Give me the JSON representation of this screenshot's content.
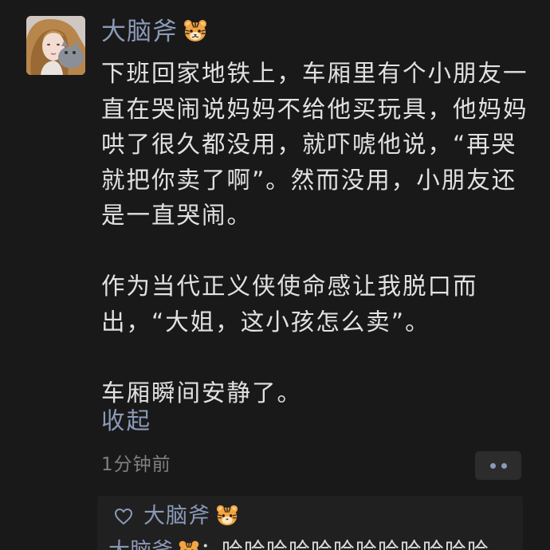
{
  "post": {
    "author": "大脑斧",
    "author_badge_icon": "tiger-face-icon",
    "paragraphs": [
      "下班回家地铁上，车厢里有个小朋友一直在哭闹说妈妈不给他买玩具，他妈妈哄了很久都没用，就吓唬他说，“再哭就把你卖了啊”。然而没用，小朋友还是一直哭闹。",
      "作为当代正义侠使命感让我脱口而出，“大姐，这小孩怎么卖”。",
      "车厢瞬间安静了。"
    ],
    "collapse_label": "收起",
    "timestamp": "1分钟前",
    "more_icon": "more-dots-icon"
  },
  "likes": {
    "icon": "heart-outline-icon",
    "names": [
      "大脑斧"
    ]
  },
  "comments": [
    {
      "author": "大脑斧",
      "separator": "：",
      "text": "哈哈哈哈哈哈哈哈哈哈哈哈"
    }
  ],
  "colors": {
    "background": "#191919",
    "link_blue": "#8b9ab8",
    "body_text": "#e1e1e1",
    "meta_gray": "#7f7f7f",
    "panel_bg": "#202020"
  }
}
